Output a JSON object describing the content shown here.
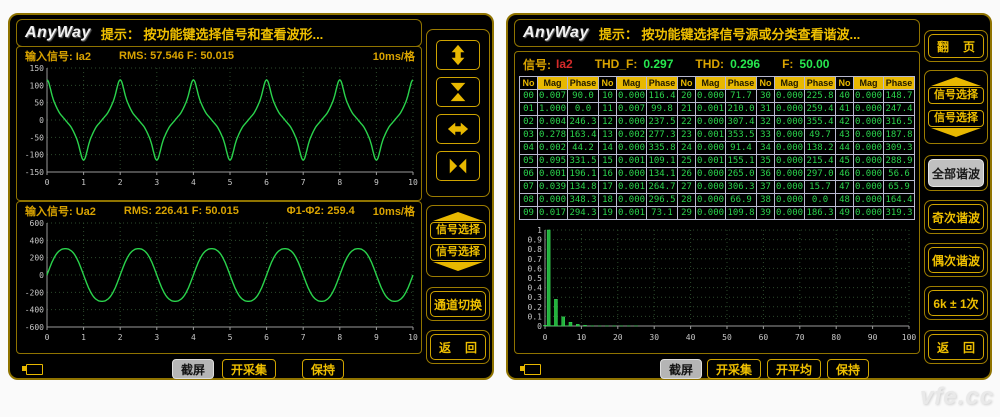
{
  "watermark": "vfe.cc",
  "colors": {
    "accent_yellow": "#e8b800",
    "border_gold": "#8f7300",
    "waveform_green": "#2ad34c",
    "value_green": "#27e84f",
    "signal_red": "#d42a2a",
    "table_header_bg": "#e8b800",
    "selected_button_bg": "#c0c0c0"
  },
  "left_panel": {
    "logo": "AnyWay",
    "hint": "提示： 按功能键选择信号和查看波形...",
    "scope1": {
      "signal": "输入信号: Ia2",
      "meas": "RMS: 57.546 F: 50.015",
      "timebase": "10ms/格"
    },
    "scope2": {
      "signal": "输入信号: Ua2",
      "meas": "RMS: 226.41 F: 50.015",
      "phase": "Φ1-Φ2: 259.4",
      "timebase": "10ms/格"
    },
    "buttons": {
      "signal_select_up": "信号选择",
      "signal_select_down": "信号选择",
      "channel_switch": "通道切换",
      "back_left": "返",
      "back_right": "回"
    },
    "bottom": {
      "screenshot": "截屏",
      "start_acquisition": "开采集",
      "hold": "保持"
    }
  },
  "right_panel": {
    "logo": "AnyWay",
    "hint": "提示： 按功能键选择信号源或分类查看谐波...",
    "info": {
      "signal_label": "信号:",
      "signal_value": "Ia2",
      "thdf_label": "THD_F:",
      "thdf_value": "0.297",
      "thd_label": "THD:",
      "thd_value": "0.296",
      "f_label": "F:",
      "f_value": "50.00"
    },
    "table": {
      "group_headers": [
        "No",
        "Mag",
        "Phase"
      ],
      "rows": [
        [
          [
            "00",
            "0.007",
            "90.0"
          ],
          [
            "10",
            "0.000",
            "116.4"
          ],
          [
            "20",
            "0.000",
            "71.7"
          ],
          [
            "30",
            "0.000",
            "225.8"
          ],
          [
            "40",
            "0.000",
            "148.7"
          ]
        ],
        [
          [
            "01",
            "1.000",
            "0.0"
          ],
          [
            "11",
            "0.007",
            "99.8"
          ],
          [
            "21",
            "0.001",
            "210.0"
          ],
          [
            "31",
            "0.000",
            "259.4"
          ],
          [
            "41",
            "0.000",
            "247.4"
          ]
        ],
        [
          [
            "02",
            "0.004",
            "246.3"
          ],
          [
            "12",
            "0.000",
            "237.5"
          ],
          [
            "22",
            "0.000",
            "307.4"
          ],
          [
            "32",
            "0.000",
            "355.4"
          ],
          [
            "42",
            "0.000",
            "316.5"
          ]
        ],
        [
          [
            "03",
            "0.278",
            "163.4"
          ],
          [
            "13",
            "0.002",
            "277.3"
          ],
          [
            "23",
            "0.001",
            "353.5"
          ],
          [
            "33",
            "0.000",
            "49.7"
          ],
          [
            "43",
            "0.000",
            "187.8"
          ]
        ],
        [
          [
            "04",
            "0.002",
            "44.2"
          ],
          [
            "14",
            "0.000",
            "335.8"
          ],
          [
            "24",
            "0.000",
            "91.4"
          ],
          [
            "34",
            "0.000",
            "138.2"
          ],
          [
            "44",
            "0.000",
            "309.3"
          ]
        ],
        [
          [
            "05",
            "0.095",
            "331.5"
          ],
          [
            "15",
            "0.001",
            "109.1"
          ],
          [
            "25",
            "0.001",
            "155.1"
          ],
          [
            "35",
            "0.000",
            "215.4"
          ],
          [
            "45",
            "0.000",
            "288.9"
          ]
        ],
        [
          [
            "06",
            "0.001",
            "196.1"
          ],
          [
            "16",
            "0.000",
            "134.1"
          ],
          [
            "26",
            "0.000",
            "265.0"
          ],
          [
            "36",
            "0.000",
            "297.0"
          ],
          [
            "46",
            "0.000",
            "56.6"
          ]
        ],
        [
          [
            "07",
            "0.039",
            "134.8"
          ],
          [
            "17",
            "0.001",
            "264.7"
          ],
          [
            "27",
            "0.000",
            "306.3"
          ],
          [
            "37",
            "0.000",
            "15.7"
          ],
          [
            "47",
            "0.000",
            "65.9"
          ]
        ],
        [
          [
            "08",
            "0.000",
            "348.3"
          ],
          [
            "18",
            "0.000",
            "296.5"
          ],
          [
            "28",
            "0.000",
            "66.9"
          ],
          [
            "38",
            "0.000",
            "0.0"
          ],
          [
            "48",
            "0.000",
            "164.4"
          ]
        ],
        [
          [
            "09",
            "0.017",
            "294.3"
          ],
          [
            "19",
            "0.001",
            "73.1"
          ],
          [
            "29",
            "0.000",
            "109.8"
          ],
          [
            "39",
            "0.000",
            "186.3"
          ],
          [
            "49",
            "0.000",
            "319.3"
          ]
        ]
      ]
    },
    "buttons": {
      "page_flip_left": "翻",
      "page_flip_right": "页",
      "signal_select_up": "信号选择",
      "signal_select_down": "信号选择",
      "all_harmonics": "全部谐波",
      "odd_harmonics": "奇次谐波",
      "even_harmonics": "偶次谐波",
      "six_k": "6k ± 1次",
      "back_left": "返",
      "back_right": "回"
    },
    "bottom": {
      "screenshot": "截屏",
      "start_acquisition": "开采集",
      "start_average": "开平均",
      "hold": "保持"
    }
  },
  "chart_data": [
    {
      "type": "line",
      "name": "Ia2-input-waveform",
      "xlim": [
        0,
        10
      ],
      "ylim": [
        -150,
        150
      ],
      "xticks": [
        0,
        1,
        2,
        3,
        4,
        5,
        6,
        7,
        8,
        9,
        10
      ],
      "yticks": [
        150,
        100,
        50,
        0,
        -50,
        -100,
        -150
      ],
      "x_unit": "10ms/格",
      "fundamental_peak": 81,
      "harmonics": [
        [
          1,
          1.0
        ],
        [
          3,
          0.278
        ],
        [
          5,
          0.095
        ],
        [
          7,
          0.039
        ],
        [
          9,
          0.017
        ]
      ],
      "phase_fn": "cos",
      "grid": true,
      "legend": "none"
    },
    {
      "type": "line",
      "name": "Ua2-input-waveform",
      "xlim": [
        0,
        10
      ],
      "ylim": [
        -600,
        600
      ],
      "xticks": [
        0,
        1,
        2,
        3,
        4,
        5,
        6,
        7,
        8,
        9,
        10
      ],
      "yticks": [
        600,
        400,
        200,
        0,
        -200,
        -400,
        -600
      ],
      "x_unit": "10ms/格",
      "fundamental_peak": 320,
      "harmonics": [
        [
          1,
          1.0
        ],
        [
          3,
          0.05
        ]
      ],
      "phase_fn": "sin",
      "grid": true,
      "legend": "none"
    },
    {
      "type": "bar",
      "name": "harmonic-spectrum",
      "xlim": [
        0,
        100
      ],
      "ylim": [
        0,
        1
      ],
      "xticks": [
        0,
        10,
        20,
        30,
        40,
        50,
        60,
        70,
        80,
        90,
        100
      ],
      "ytick_labels": [
        "1",
        "0.9",
        "0.8",
        "0.7",
        "0.6",
        "0.5",
        "0.4",
        "0.3",
        "0.2",
        "0.1",
        "0"
      ],
      "orders": [
        0,
        1,
        2,
        3,
        4,
        5,
        6,
        7,
        8,
        9,
        10,
        11,
        12,
        13,
        14,
        15,
        16,
        17,
        18,
        19,
        20,
        21,
        22,
        23,
        24,
        25
      ],
      "values": [
        0.007,
        1.0,
        0.004,
        0.278,
        0.002,
        0.095,
        0.001,
        0.039,
        0.0,
        0.017,
        0.0,
        0.007,
        0.0,
        0.002,
        0.0,
        0.001,
        0.0,
        0.001,
        0.0,
        0.001,
        0.0,
        0.001,
        0.0,
        0.001,
        0.0,
        0.001
      ],
      "grid": true,
      "legend": "none"
    }
  ]
}
